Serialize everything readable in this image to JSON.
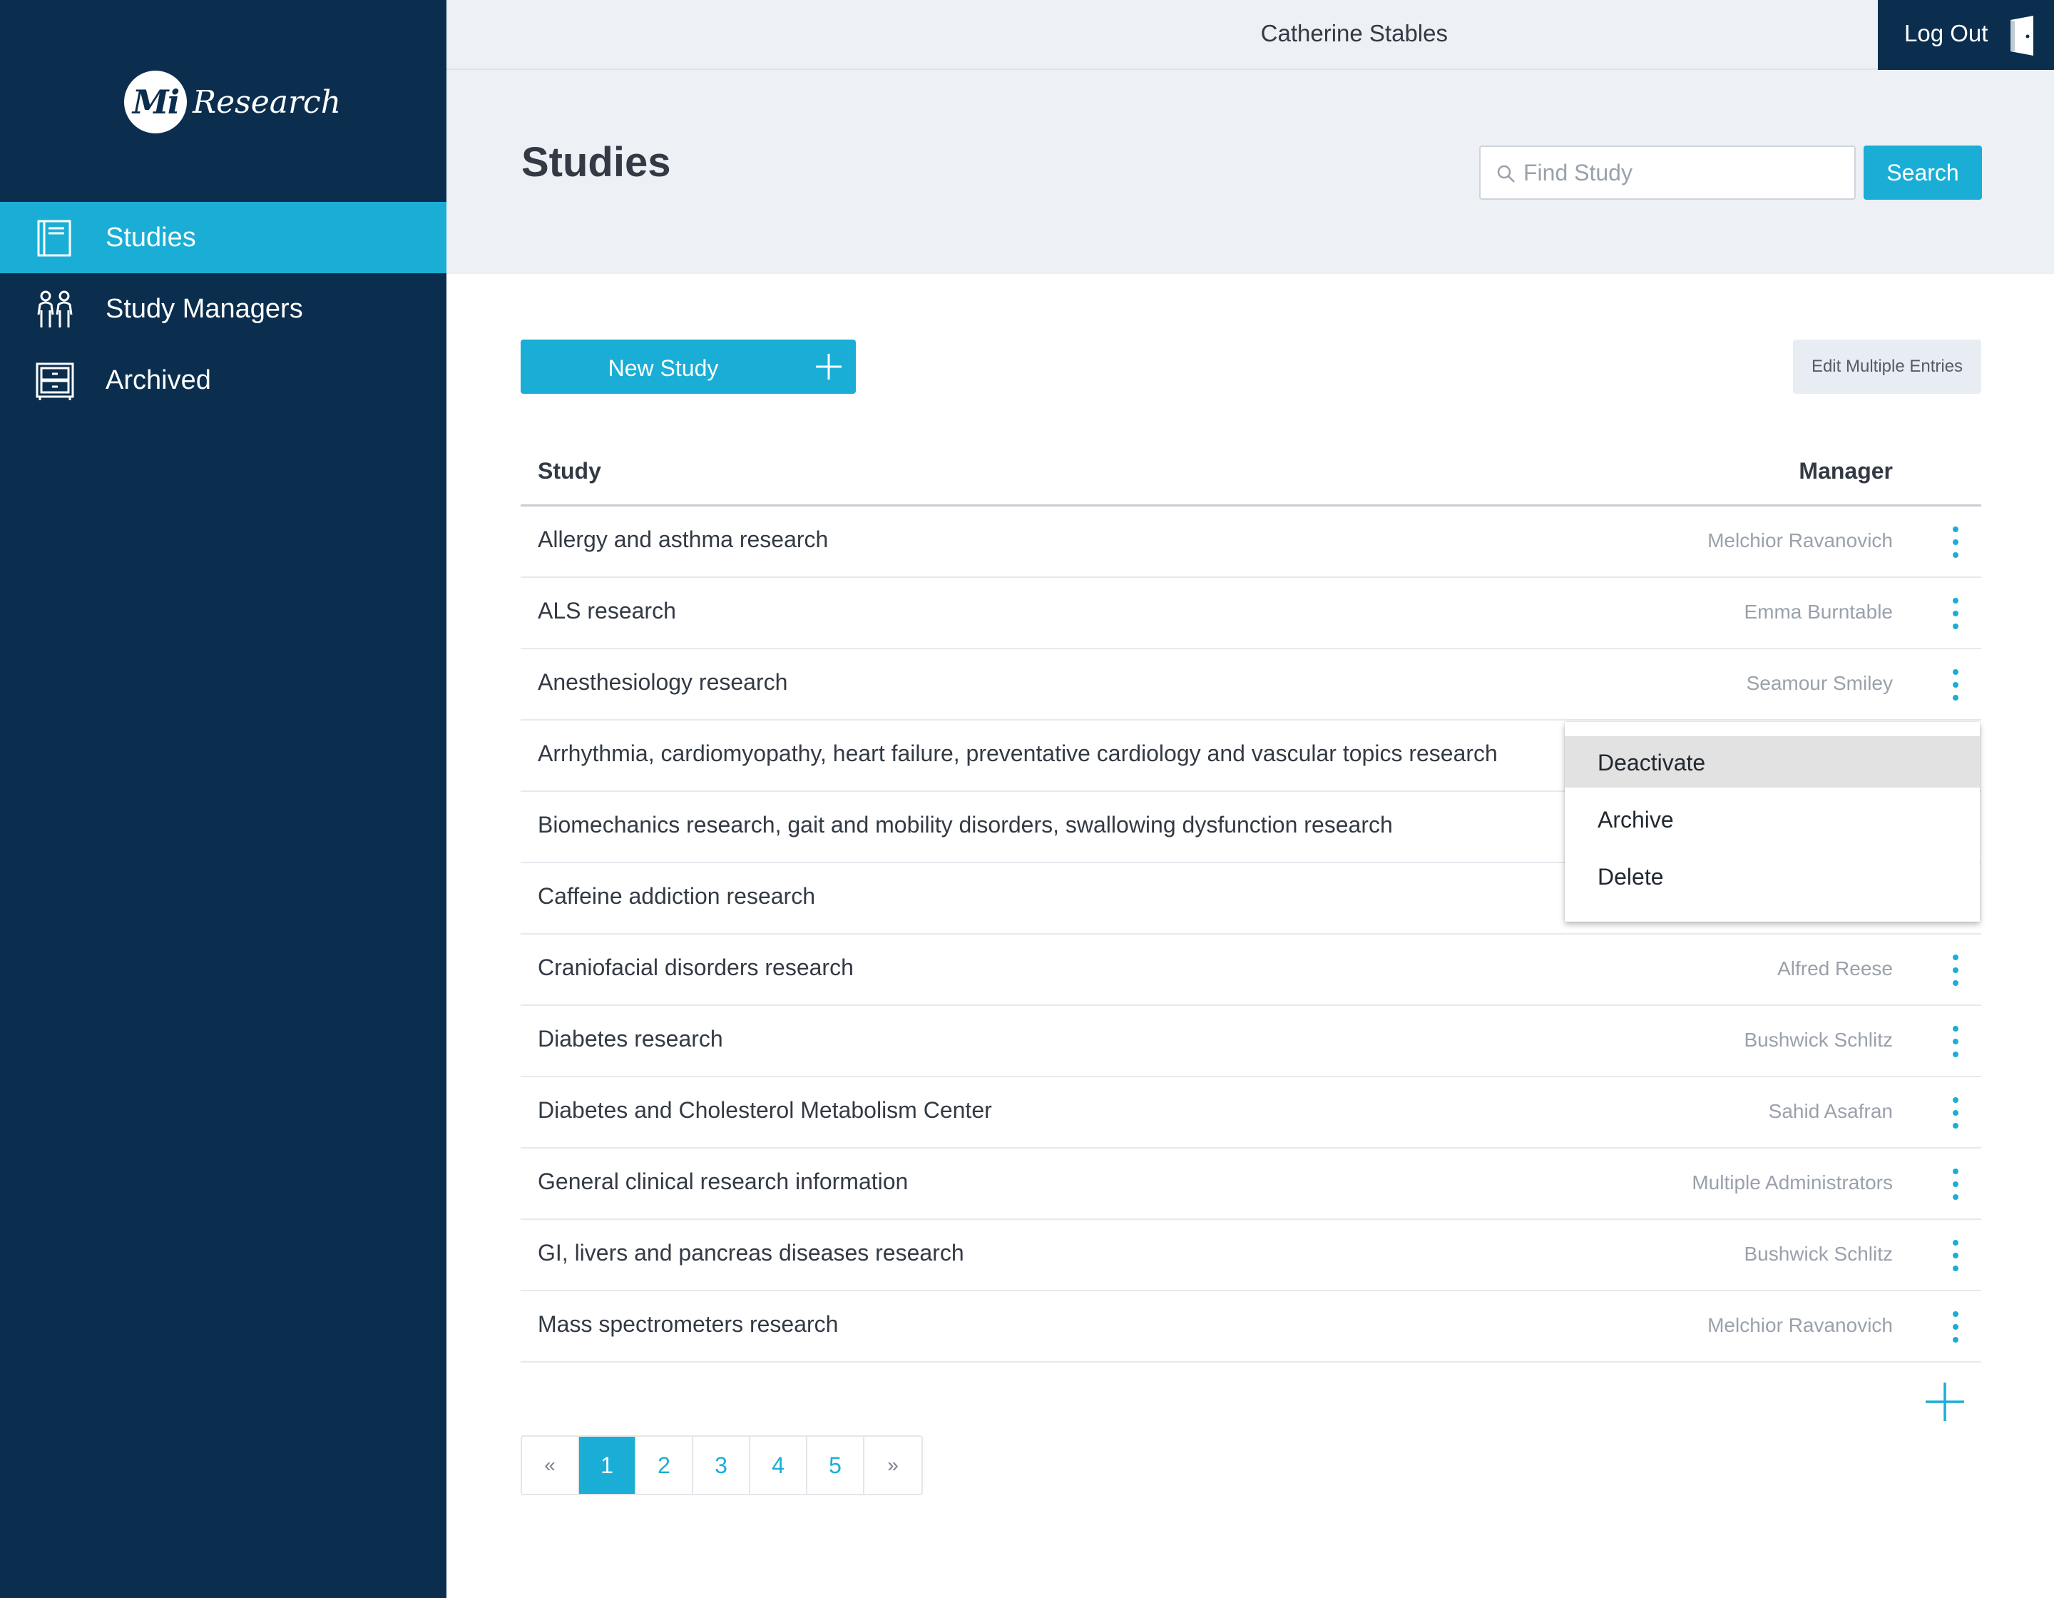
{
  "brand": {
    "mark": "Mi",
    "name": "Research"
  },
  "sidebar": {
    "items": [
      {
        "label": "Studies",
        "icon": "book-icon",
        "active": true
      },
      {
        "label": "Study Managers",
        "icon": "people-icon",
        "active": false
      },
      {
        "label": "Archived",
        "icon": "cabinet-icon",
        "active": false
      }
    ]
  },
  "topbar": {
    "user_name": "Catherine Stables",
    "logout_label": "Log Out"
  },
  "header": {
    "title": "Studies",
    "search_placeholder": "Find Study",
    "search_value": "",
    "search_button": "Search"
  },
  "toolbar": {
    "new_study_label": "New Study",
    "edit_multiple_label": "Edit Multiple Entries"
  },
  "table": {
    "columns": {
      "study": "Study",
      "manager": "Manager"
    },
    "rows": [
      {
        "study": "Allergy and asthma research",
        "manager": "Melchior Ravanovich"
      },
      {
        "study": "ALS research",
        "manager": "Emma Burntable"
      },
      {
        "study": "Anesthesiology research",
        "manager": "Seamour Smiley"
      },
      {
        "study": "Arrhythmia, cardiomyopathy, heart failure, preventative cardiology and vascular topics research",
        "manager": ""
      },
      {
        "study": "Biomechanics research, gait and mobility disorders, swallowing dysfunction research",
        "manager": ""
      },
      {
        "study": "Caffeine addiction research",
        "manager": ""
      },
      {
        "study": "Craniofacial disorders research",
        "manager": "Alfred Reese"
      },
      {
        "study": "Diabetes research",
        "manager": "Bushwick Schlitz"
      },
      {
        "study": "Diabetes and Cholesterol Metabolism Center",
        "manager": "Sahid Asafran"
      },
      {
        "study": "General clinical research information",
        "manager": "Multiple Administrators"
      },
      {
        "study": "GI, livers and pancreas diseases research",
        "manager": "Bushwick Schlitz"
      },
      {
        "study": "Mass spectrometers research",
        "manager": "Melchior Ravanovich"
      }
    ]
  },
  "context_menu": {
    "items": [
      "Deactivate",
      "Archive",
      "Delete"
    ],
    "highlighted": "Deactivate"
  },
  "pagination": {
    "prev": "«",
    "pages": [
      "1",
      "2",
      "3",
      "4",
      "5"
    ],
    "current": "1",
    "next": "»"
  },
  "colors": {
    "sidebar": "#0b2e4e",
    "accent": "#1aaed6",
    "header_bg": "#edf0f5"
  }
}
